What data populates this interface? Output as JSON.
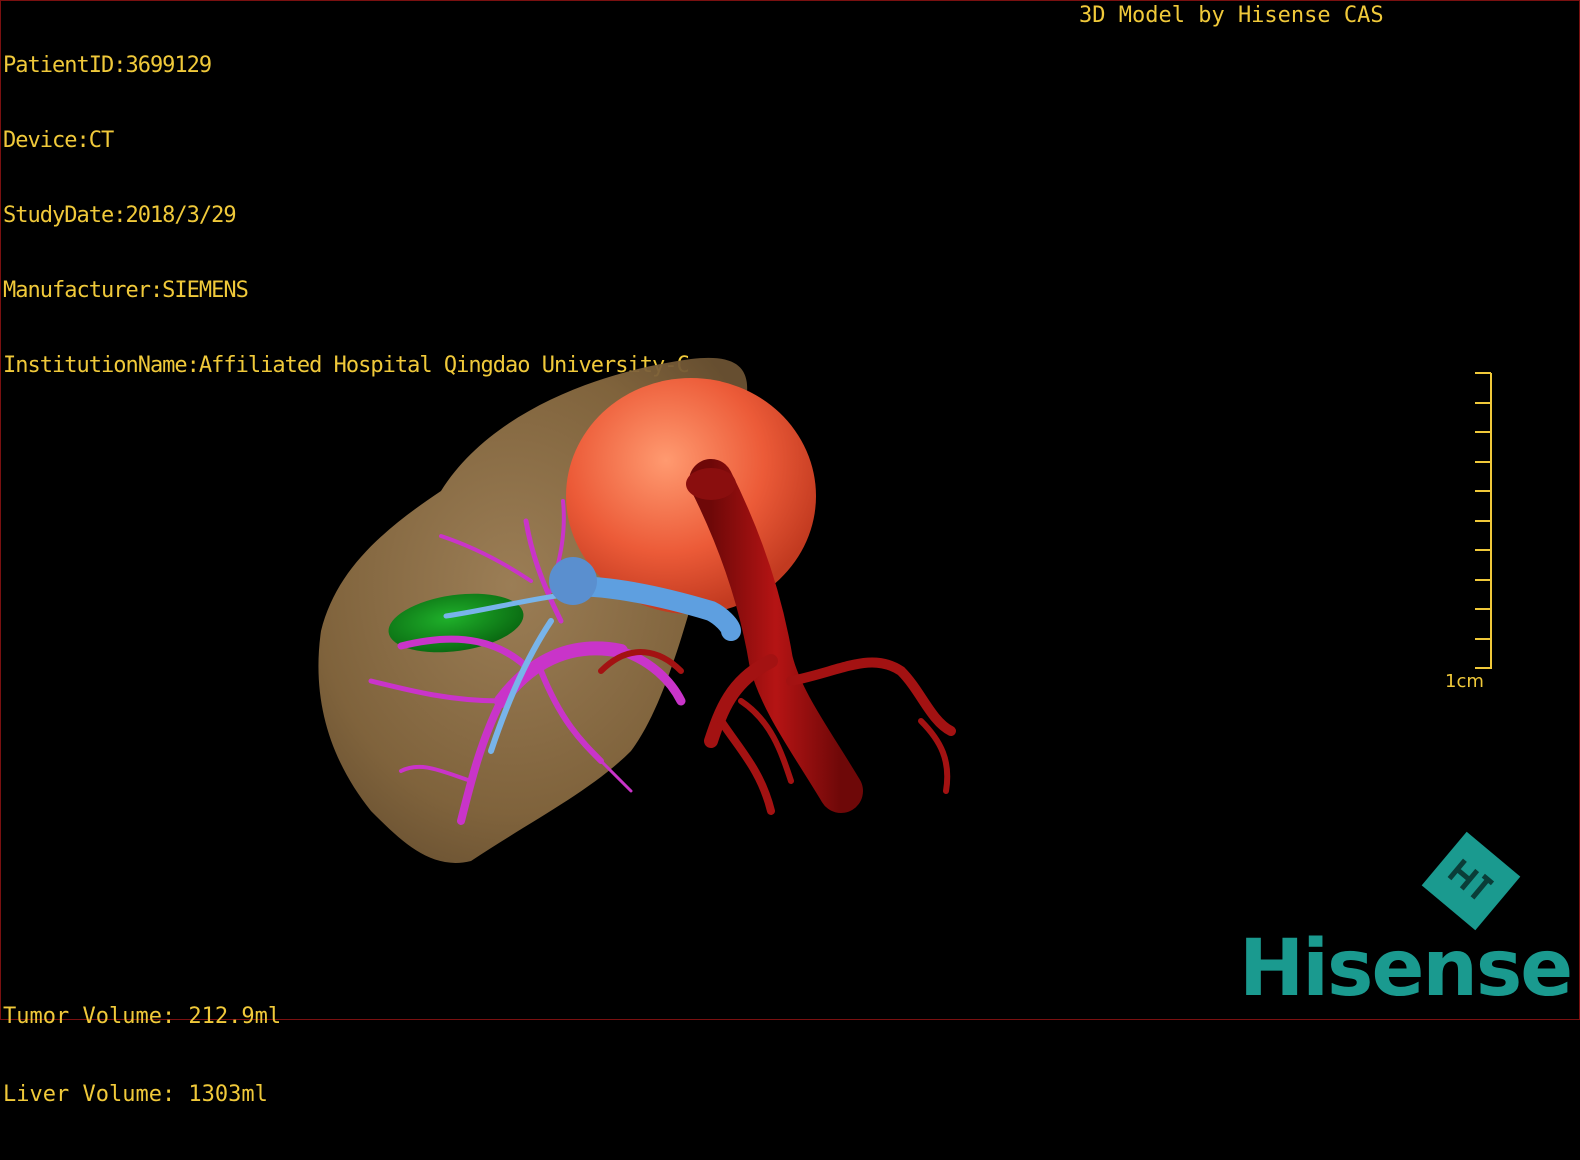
{
  "header": {
    "patient_id": "PatientID:3699129",
    "device": "Device:CT",
    "study_date": "StudyDate:2018/3/29",
    "manufacturer": "Manufacturer:SIEMENS",
    "institution": "InstitutionName:Affiliated Hospital Qingdao University-C"
  },
  "credit": "3D Model by Hisense CAS",
  "measurements": {
    "tumor_volume": "Tumor Volume: 212.9ml",
    "liver_volume": "Liver Volume: 1303ml"
  },
  "scale_bar": {
    "label": "1cm"
  },
  "brand": {
    "name": "Hisense",
    "color": "#1a9a8f"
  },
  "colors": {
    "overlay_text": "#f0c93a",
    "liver": "#8c6e48",
    "tumor": "#e8583a",
    "artery": "#9c1010",
    "portal_vein": "#cc33cc",
    "hepatic_vein": "#5aa0e0",
    "gallbladder": "#0f8a1a"
  },
  "icons": {
    "logo": "hisense-logo-icon"
  }
}
